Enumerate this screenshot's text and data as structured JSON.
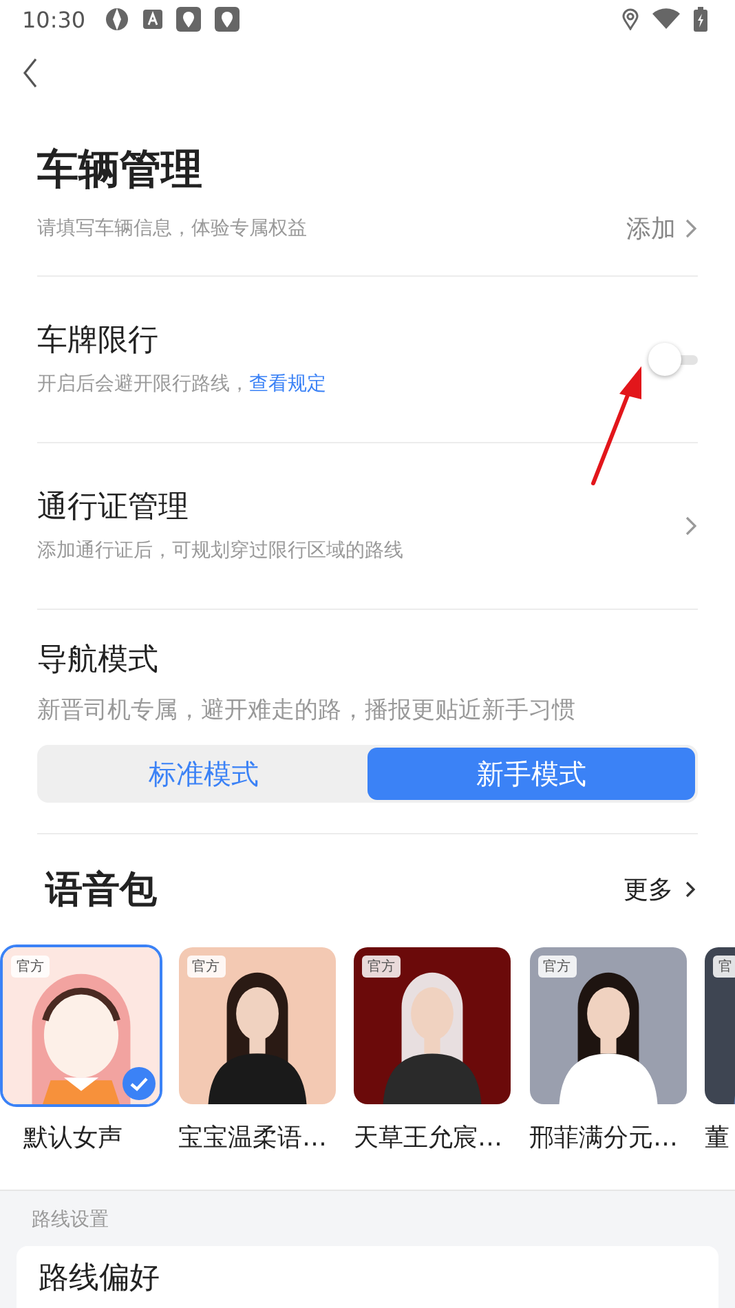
{
  "status_bar": {
    "time": "10:30"
  },
  "header": {
    "back": true
  },
  "vehicle": {
    "title": "车辆管理",
    "subtitle": "请填写车辆信息，体验专属权益",
    "action": "添加"
  },
  "settings": [
    {
      "kind": "toggle",
      "title": "车牌限行",
      "subtitle": "开启后会避开限行路线，",
      "link": "查看规定",
      "on": false
    },
    {
      "kind": "link",
      "title": "通行证管理",
      "subtitle": "添加通行证后，可规划穿过限行区域的路线"
    }
  ],
  "nav_mode": {
    "title": "导航模式",
    "subtitle": "新晋司机专属，避开难走的路，播报更贴近新手习惯",
    "tabs": [
      {
        "label": "标准模式",
        "selected": false
      },
      {
        "label": "新手模式",
        "selected": true
      }
    ]
  },
  "voice_packs": {
    "title": "语音包",
    "more": "更多",
    "items": [
      {
        "name": "默认女声",
        "badge": "官方",
        "selected": true,
        "kind": "cartoon"
      },
      {
        "name": "宝宝温柔语…",
        "badge": "官方",
        "selected": false
      },
      {
        "name": "天草王允宸…",
        "badge": "官方",
        "selected": false
      },
      {
        "name": "邢菲满分元…",
        "badge": "官方",
        "selected": false
      },
      {
        "name": "董",
        "badge": "官",
        "selected": false
      }
    ]
  },
  "route_settings": {
    "section": "路线设置",
    "first_item": "路线偏好"
  },
  "annotation_arrow": true
}
